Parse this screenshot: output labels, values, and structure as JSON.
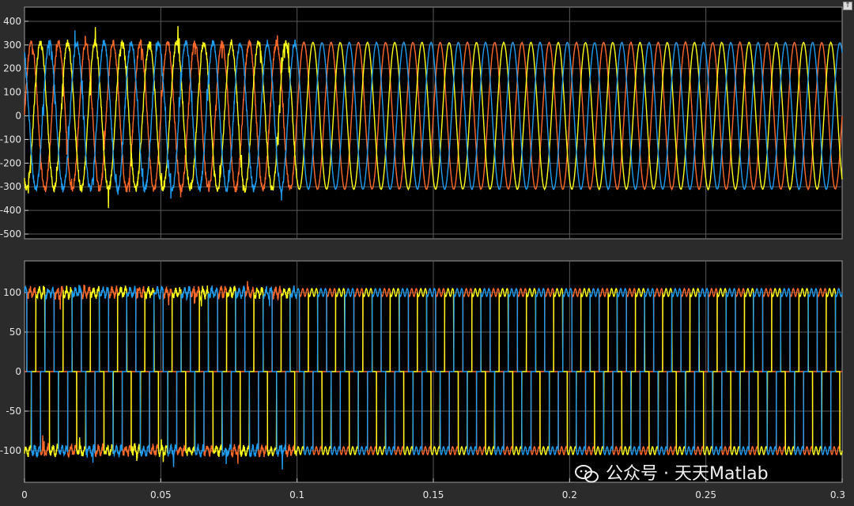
{
  "chart_data": [
    {
      "type": "line",
      "title": "",
      "xlabel": "",
      "ylabel": "",
      "xlim": [
        0,
        0.3
      ],
      "ylim": [
        -520,
        460
      ],
      "yticks": [
        400,
        300,
        200,
        100,
        0,
        -100,
        -200,
        -300,
        -400,
        -500
      ],
      "grid": true,
      "waveform": "sinusoid",
      "frequency_hz": 100,
      "amplitude": 310,
      "transient_until": 0.1,
      "series": [
        {
          "color": "#ff6a2b",
          "phase_deg": 0
        },
        {
          "color": "#ffff1a",
          "phase_deg": -120
        },
        {
          "color": "#1f9cf0",
          "phase_deg": 120
        }
      ]
    },
    {
      "type": "line",
      "title": "",
      "xlabel": "",
      "ylabel": "",
      "xlim": [
        0,
        0.3
      ],
      "ylim": [
        -140,
        140
      ],
      "yticks": [
        100,
        50,
        0,
        -50,
        -100
      ],
      "grid": true,
      "waveform": "square",
      "frequency_hz": 100,
      "amplitude": 100,
      "ripple": 5,
      "transient_until": 0.1,
      "series": [
        {
          "color": "#ff6a2b",
          "phase_deg": 0
        },
        {
          "color": "#ffff1a",
          "phase_deg": -120
        },
        {
          "color": "#1f9cf0",
          "phase_deg": 120
        }
      ]
    }
  ],
  "x_ticks": [
    "0",
    "0.05",
    "0.1",
    "0.15",
    "0.2",
    "0.25",
    "0.3"
  ],
  "x_tick_values": [
    0,
    0.05,
    0.1,
    0.15,
    0.2,
    0.25,
    0.3
  ],
  "watermark": {
    "text": "公众号 · 天天Matlab",
    "icon": "wechat-icon"
  },
  "corner_button": {
    "icon": "restore-icon",
    "glyph": "↑"
  }
}
